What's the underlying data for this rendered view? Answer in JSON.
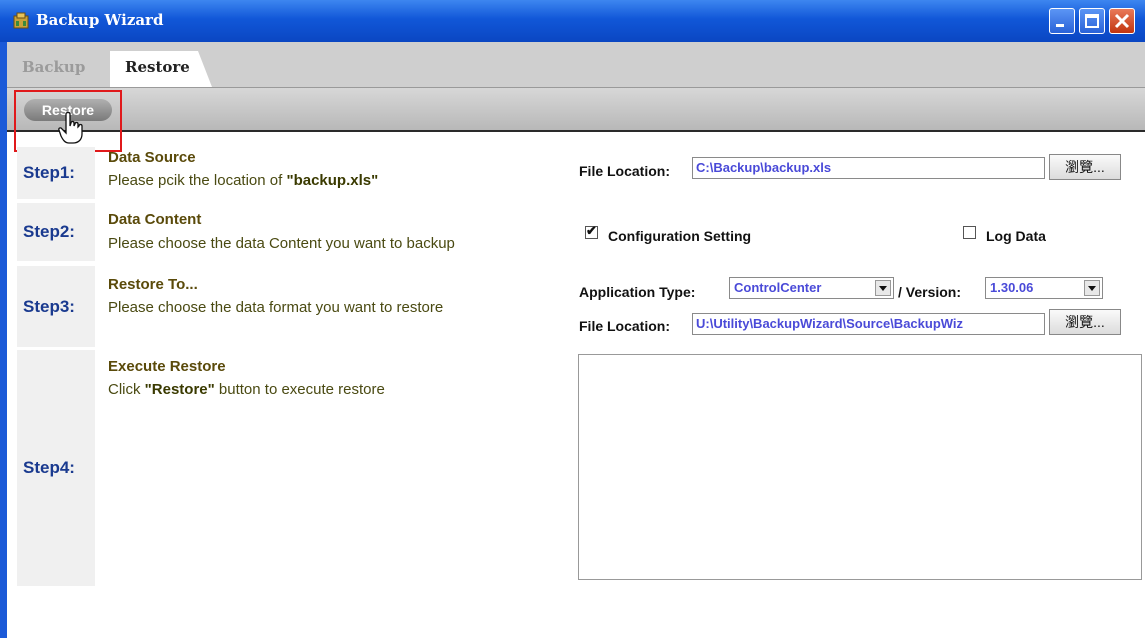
{
  "window": {
    "title": "Backup Wizard"
  },
  "tabs": [
    {
      "label": "Backup"
    },
    {
      "label": "Restore"
    }
  ],
  "toolbar": {
    "restore_button_label": "Restore"
  },
  "steps": [
    {
      "label": "Step1:",
      "title": "Data Source",
      "desc_prefix": "Please pcik the location of ",
      "desc_bold": "\"backup.xls\"",
      "desc_suffix": ""
    },
    {
      "label": "Step2:",
      "title": "Data Content",
      "desc": "Please choose the data Content you want to backup"
    },
    {
      "label": "Step3:",
      "title": "Restore To...",
      "desc": "Please choose the data format you want to restore"
    },
    {
      "label": "Step4:",
      "title": "Execute Restore",
      "desc_prefix": "Click ",
      "desc_bold": "\"Restore\"",
      "desc_suffix": " button to execute restore"
    }
  ],
  "step1_controls": {
    "file_location_label": "File Location:",
    "file_location_value": "C:\\Backup\\backup.xls",
    "browse_label": "瀏覽..."
  },
  "step2_controls": {
    "config_label": "Configuration Setting",
    "config_checked": true,
    "log_label": "Log Data",
    "log_checked": false
  },
  "step3_controls": {
    "app_type_label": "Application Type:",
    "app_type_value": "ControlCenter",
    "version_label": "/ Version:",
    "version_value": "1.30.06",
    "file_location_label": "File Location:",
    "file_location_value": "U:\\Utility\\BackupWizard\\Source\\BackupWiz",
    "browse_label": "瀏覽..."
  },
  "colors": {
    "titlebar": "#1157d8",
    "highlight": "#e0191b",
    "step_label": "#1a3a8f",
    "field_text": "#4a4ad8"
  }
}
